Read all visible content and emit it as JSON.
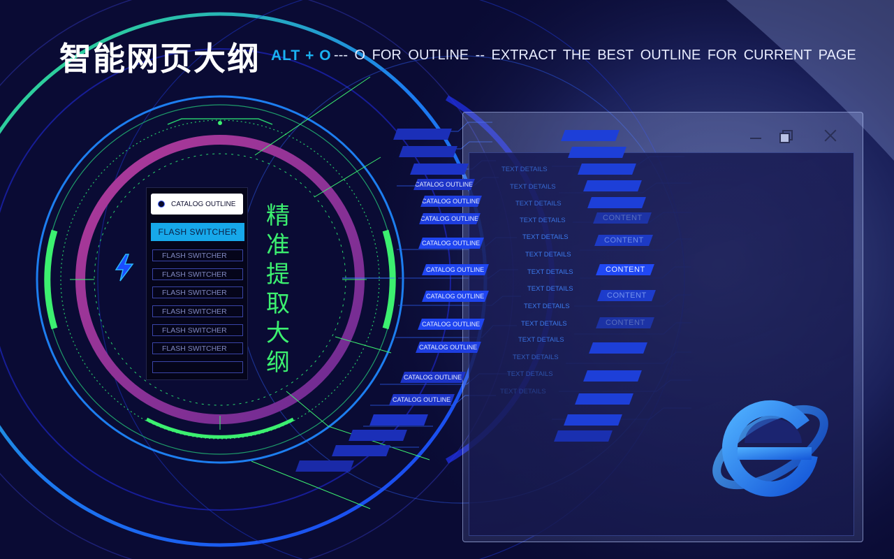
{
  "header": {
    "title": "智能网页大纲",
    "shortcut": "ALT + O",
    "tagline": "--- O  FOR   OUTLINE -- EXTRACT  THE  BEST  OUTLINE  FOR CURRENT  PAGE"
  },
  "side_caption": "精准提取大纲",
  "panel": {
    "catalog_label": "CATALOG OUTLINE",
    "active_label": "FLASH SWITCHER",
    "items": [
      "FLASH SWITCHER",
      "FLASH SWITCHER",
      "FLASH SWITCHER",
      "FLASH SWITCHER",
      "FLASH SWITCHER",
      "FLASH SWITCHER"
    ]
  },
  "catalog_bars": [
    "CATALOG OUTLINE",
    "CATALOG OUTLINE",
    "CATALOG OUTLINE",
    "CATALOG OUTLINE",
    "CATALOG OUTLINE",
    "CATALOG OUTLINE",
    "CATALOG OUTLINE",
    "CATALOG OUTLINE",
    "CATALOG OUTLINE",
    "CATALOG OUTLINE"
  ],
  "text_details": [
    "TEXT DETAILS",
    "TEXT DETAILS",
    "TEXT DETAILS",
    "TEXT DETAILS",
    "TEXT DETAILS",
    "TEXT DETAILS",
    "TEXT DETAILS",
    "TEXT DETAILS",
    "TEXT DETAILS",
    "TEXT DETAILS",
    "TEXT DETAILS",
    "TEXT DETAILS",
    "TEXT DETAILS",
    "TEXT DETAILS"
  ],
  "content_bars": [
    "CONTENT",
    "CONTENT",
    "CONTENT",
    "CONTENT",
    "CONTENT"
  ],
  "window_controls": {
    "minimize": "minimize-icon",
    "maximize": "restore-icon",
    "close": "close-icon"
  },
  "colors": {
    "background": "#0a0b34",
    "accent_green": "#3cf070",
    "accent_blue": "#1ab2f2",
    "magenta_ring": "#8e2f8f",
    "bar_blue": "#1d3fd8"
  },
  "icons": [
    "lightning-bolt-icon",
    "browser-e-logo-icon"
  ]
}
